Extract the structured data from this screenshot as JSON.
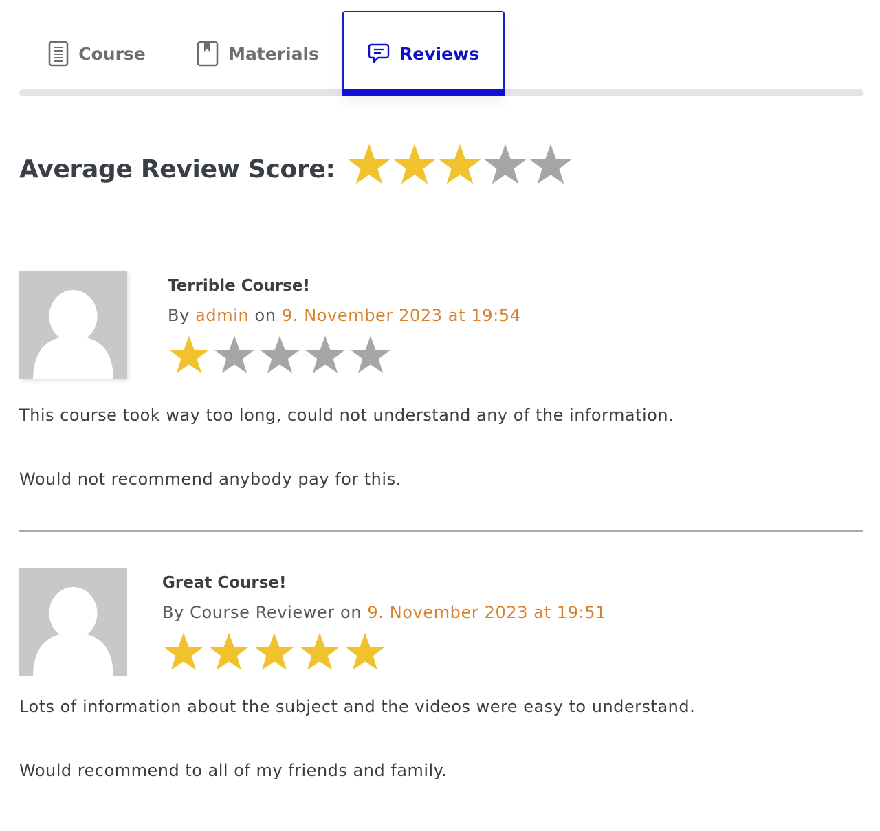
{
  "tabs": [
    {
      "label": "Course",
      "icon": "document-icon",
      "active": false
    },
    {
      "label": "Materials",
      "icon": "book-icon",
      "active": false
    },
    {
      "label": "Reviews",
      "icon": "chat-bubble-icon",
      "active": true
    }
  ],
  "average": {
    "label": "Average Review Score:",
    "rating": 3,
    "max": 5
  },
  "reviews": [
    {
      "title": "Terrible Course!",
      "by_label": "By",
      "author": "admin",
      "on_label": "on",
      "date": "9. November 2023 at 19:54",
      "rating": 1,
      "max": 5,
      "paragraphs": [
        "This course took way too long, could not understand any of the information.",
        "Would not recommend anybody pay for this."
      ]
    },
    {
      "title": "Great Course!",
      "by_label": "By",
      "author": "Course Reviewer",
      "on_label": "on",
      "date": "9. November 2023 at 19:51",
      "rating": 5,
      "max": 5,
      "paragraphs": [
        "Lots of information about the subject and the videos were easy to understand.",
        "Would recommend to all of my friends and family."
      ]
    }
  ],
  "colors": {
    "star_filled": "#F2C12E",
    "star_empty": "#A6A6A8",
    "accent": "#D9812A",
    "active_tab": "#1010C8",
    "text": "#3A3F45"
  }
}
